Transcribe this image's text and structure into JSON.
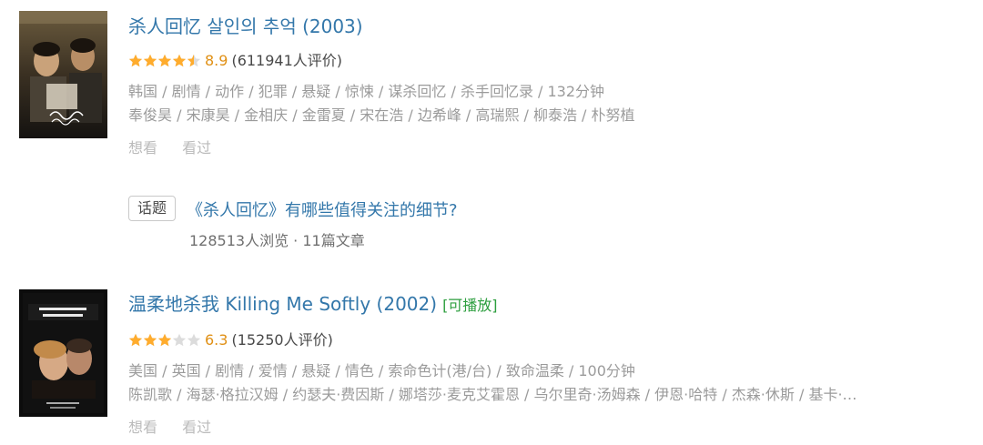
{
  "results": [
    {
      "title": "杀人回忆 살인의 추억 (2003)",
      "playable": "",
      "rating": {
        "score": "8.9",
        "count_text": "(611941人评价)",
        "stars": 4.5
      },
      "meta_line1": "韩国 / 剧情 / 动作 / 犯罪 / 悬疑 / 惊悚 / 谋杀回忆 / 杀手回忆录 / 132分钟",
      "meta_line2": "奉俊昊 / 宋康昊 / 金相庆 / 金雷夏 / 宋在浩 / 边希峰 / 高瑞熙 / 柳泰浩 / 朴努植",
      "actions": {
        "want": "想看",
        "seen": "看过"
      }
    },
    {
      "title": "温柔地杀我 Killing Me Softly (2002)",
      "playable": "[可播放]",
      "rating": {
        "score": "6.3",
        "count_text": "(15250人评价)",
        "stars": 3
      },
      "meta_line1": "美国 / 英国 / 剧情 / 爱情 / 悬疑 / 情色 / 索命色计(港/台) / 致命温柔 / 100分钟",
      "meta_line2": "陈凯歌 / 海瑟·格拉汉姆 / 约瑟夫·费因斯 / 娜塔莎·麦克艾霍恩 / 乌尔里奇·汤姆森 / 伊恩·哈特 / 杰森·休斯 / 基卡·…",
      "actions": {
        "want": "想看",
        "seen": "看过"
      }
    }
  ],
  "topic": {
    "tag": "话题",
    "title": "《杀人回忆》有哪些值得关注的细节?",
    "stats": "128513人浏览 · 11篇文章"
  },
  "colors": {
    "link": "#3377aa",
    "star": "#ffac2d",
    "star_empty": "#dcdcdc",
    "score": "#e09015",
    "playable": "#2c9e3e"
  }
}
